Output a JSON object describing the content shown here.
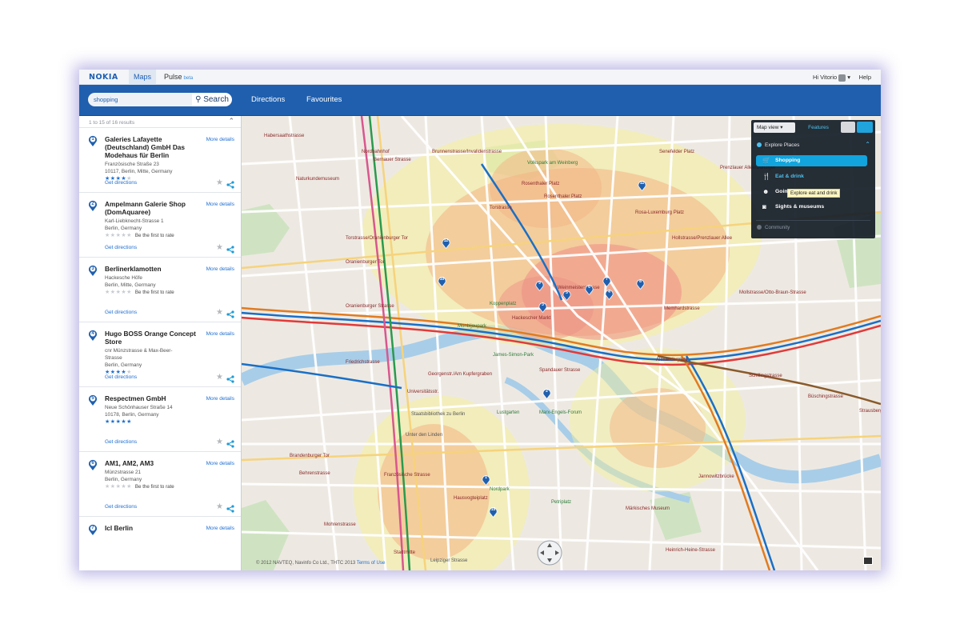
{
  "topbar": {
    "logo": "NOKIA",
    "tabs": [
      {
        "label": "Maps",
        "active": true
      },
      {
        "label": "Pulse",
        "badge": "beta"
      }
    ],
    "user": "Hi Vitorio",
    "help": "Help"
  },
  "nav": {
    "search_value": "shopping",
    "search_button": "Search",
    "directions": "Directions",
    "favourites": "Favourites"
  },
  "sidebar": {
    "results_count": "1 to 15 of 16 results",
    "results": [
      {
        "number": "1",
        "name": "Galeries Lafayette (Deutschland) GmbH Das Modehaus für Berlin",
        "address": [
          "Französische Straße 23",
          "10117, Berlin, Mitte, Germany"
        ],
        "rating": 4,
        "rating_text": "",
        "more": "More details",
        "directions": "Get directions"
      },
      {
        "number": "2",
        "name": "Ampelmann Galerie Shop (DomAquaree)",
        "address": [
          "Karl-Liebknecht-Strasse 1",
          "Berlin, Germany"
        ],
        "rating": 0,
        "rating_text": "Be the first to rate",
        "more": "More details",
        "directions": "Get directions"
      },
      {
        "number": "3",
        "name": "Berlinerklamotten",
        "address": [
          "Hackesche Höfe",
          "Berlin, Mitte, Germany"
        ],
        "rating": 0,
        "rating_text": "Be the first to rate",
        "more": "More details",
        "directions": "Get directions"
      },
      {
        "number": "4",
        "name": "Hugo BOSS Orange Concept Store",
        "address": [
          "cnr Münzstrasse & Max-Beer-",
          "Strasse",
          "Berlin, Germany"
        ],
        "rating": 4,
        "rating_text": "",
        "more": "More details",
        "directions": "Get directions"
      },
      {
        "number": "5",
        "name": "Respectmen GmbH",
        "address": [
          "Neue Schönhauser Straße 14",
          "10178, Berlin, Germany"
        ],
        "rating": 5,
        "rating_text": "",
        "more": "More details",
        "directions": "Get directions"
      },
      {
        "number": "6",
        "name": "AM1, AM2, AM3",
        "address": [
          "Münzstrasse 21",
          "Berlin, Germany"
        ],
        "rating": 0,
        "rating_text": "Be the first to rate",
        "more": "More details",
        "directions": "Get directions"
      },
      {
        "number": "7",
        "name": "Icl Berlin",
        "address": [],
        "rating": 0,
        "rating_text": "",
        "more": "More details",
        "directions": ""
      }
    ]
  },
  "panel": {
    "map_view": "Map view",
    "features": "Features",
    "explore": "Explore Places",
    "items": [
      {
        "label": "Shopping",
        "icon": "cart-icon"
      },
      {
        "label": "Eat & drink",
        "icon": "fork-knife-icon"
      },
      {
        "label": "Going out",
        "icon": "mask-icon"
      },
      {
        "label": "Sights & museums",
        "icon": "camera-icon"
      }
    ],
    "tooltip": "Explore eat and drink",
    "community": "Community"
  },
  "map": {
    "labels": [
      {
        "t": "Habersaathstrasse",
        "c": "red"
      },
      {
        "t": "Nordbahnhof",
        "c": "red"
      },
      {
        "t": "Bernauer Strasse",
        "c": "red"
      },
      {
        "t": "Brunnenstrasse/Invalidenstrasse",
        "c": "red"
      },
      {
        "t": "Naturkundemuseum",
        "c": "red"
      },
      {
        "t": "Volkspark am Weinberg",
        "c": "green"
      },
      {
        "t": "Senefelder Platz",
        "c": "red"
      },
      {
        "t": "Prenzlauer Allee/Danziger",
        "c": "red"
      },
      {
        "t": "Rosenthaler Platz",
        "c": "red"
      },
      {
        "t": "Torstrasse",
        "c": "red"
      },
      {
        "t": "Rosa-Luxemburg Platz",
        "c": "red"
      },
      {
        "t": "Hollstrasse/Prenzlauer Allee",
        "c": "red"
      },
      {
        "t": "Torstrasse/Oranienburger Tor",
        "c": "red"
      },
      {
        "t": "Oranienburger Tor",
        "c": "red"
      },
      {
        "t": "Weinmeisterstrasse",
        "c": "red"
      },
      {
        "t": "Oranienburger Strasse",
        "c": "red"
      },
      {
        "t": "Monbijoupark",
        "c": "green"
      },
      {
        "t": "Hackescher Markt",
        "c": "red"
      },
      {
        "t": "Memhardstrasse",
        "c": "red"
      },
      {
        "t": "Alexanderplatz",
        "c": "red"
      },
      {
        "t": "James-Simon-Park",
        "c": "green"
      },
      {
        "t": "Spandauer Strasse",
        "c": "red"
      },
      {
        "t": "Friedrichstrasse",
        "c": "red"
      },
      {
        "t": "Georgenstr./Am Kupfergraben",
        "c": "red"
      },
      {
        "t": "Universitätsstr.",
        "c": "red"
      },
      {
        "t": "Lustgarten",
        "c": "green"
      },
      {
        "t": "Marx-Engels-Forum",
        "c": "green"
      },
      {
        "t": "Staatsbibliothek zu Berlin",
        "c": "grey"
      },
      {
        "t": "Unter den Linden",
        "c": "grey"
      },
      {
        "t": "Brandenburger Tor",
        "c": "red"
      },
      {
        "t": "Behrenstrasse",
        "c": "red"
      },
      {
        "t": "Französische Strasse",
        "c": "red"
      },
      {
        "t": "Hausvogteiplatz",
        "c": "red"
      },
      {
        "t": "Nordpark",
        "c": "green"
      },
      {
        "t": "Petriplatz",
        "c": "green"
      },
      {
        "t": "Märkisches Museum",
        "c": "red"
      },
      {
        "t": "Jannowitzbrücke",
        "c": "red"
      },
      {
        "t": "Mohrenstrasse",
        "c": "red"
      },
      {
        "t": "Stadtmitte",
        "c": "red"
      },
      {
        "t": "Leipziger Strasse",
        "c": "grey"
      },
      {
        "t": "Heinrich-Heine-Strasse",
        "c": "red"
      },
      {
        "t": "Schillingstrasse",
        "c": "red"
      },
      {
        "t": "Strausberger Platz",
        "c": "red"
      },
      {
        "t": "Büschingstrasse",
        "c": "red"
      },
      {
        "t": "Mollstrasse/Otto-Braun-Strasse",
        "c": "red"
      },
      {
        "t": "Koppenplatz",
        "c": "green"
      },
      {
        "t": "Rosenthaler Platz",
        "c": "red"
      }
    ],
    "pins": [
      "1",
      "2",
      "3",
      "4",
      "5",
      "6",
      "7",
      "8",
      "9",
      "10",
      "11",
      "12",
      "15"
    ],
    "copyright": "© 2012 NAVTEQ, Navinfo Co Ltd., THTC 2013",
    "terms": "Terms of Use"
  }
}
